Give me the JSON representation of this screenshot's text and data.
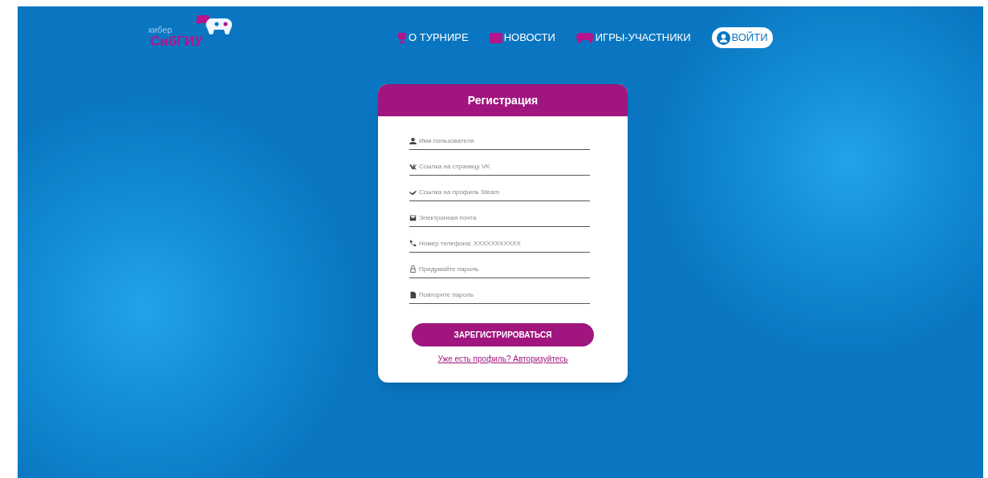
{
  "logo": {
    "top": "кибер",
    "bottom": "СибГИУ"
  },
  "nav": [
    {
      "label": "О ТУРНИРЕ"
    },
    {
      "label": "НОВОСТИ"
    },
    {
      "label": "ИГРЫ-УЧАСТНИКИ"
    }
  ],
  "login_button": "ВОЙТИ",
  "form": {
    "title": "Регистрация",
    "fields": [
      {
        "placeholder": "Имя пользователя"
      },
      {
        "placeholder": "Ссылка на страницу VK"
      },
      {
        "placeholder": "Ссылка на профиль Steam"
      },
      {
        "placeholder": "Электронная почта"
      },
      {
        "placeholder": "Номер телефона: XXXXXXXXXXX"
      },
      {
        "placeholder": "Придумайте пароль"
      },
      {
        "placeholder": "Повторите пароль"
      }
    ],
    "submit": "ЗАРЕГИСТРИРОВАТЬСЯ",
    "login_link": "Уже есть профиль? Авторизуйтесь"
  }
}
